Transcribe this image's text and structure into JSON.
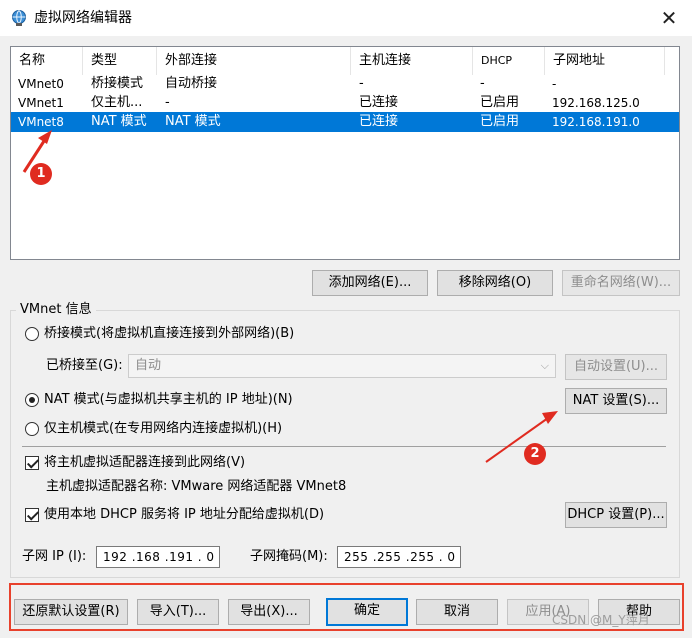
{
  "window": {
    "title": "虚拟网络编辑器",
    "close_icon": "✕"
  },
  "table": {
    "headers": [
      "名称",
      "类型",
      "外部连接",
      "主机连接",
      "DHCP",
      "子网地址"
    ],
    "rows": [
      {
        "name": "VMnet0",
        "type": "桥接模式",
        "external": "自动桥接",
        "host": "-",
        "dhcp": "-",
        "subnet": "-"
      },
      {
        "name": "VMnet1",
        "type": "仅主机...",
        "external": "-",
        "host": "已连接",
        "dhcp": "已启用",
        "subnet": "192.168.125.0"
      },
      {
        "name": "VMnet8",
        "type": "NAT 模式",
        "external": "NAT 模式",
        "host": "已连接",
        "dhcp": "已启用",
        "subnet": "192.168.191.0"
      }
    ],
    "selected_index": 2
  },
  "list_buttons": {
    "add": "添加网络(E)...",
    "remove": "移除网络(O)",
    "rename": "重命名网络(W)..."
  },
  "vmnet_info": {
    "title": "VMnet 信息",
    "bridge_mode": "桥接模式(将虚拟机直接连接到外部网络)(B)",
    "bridged_to_label": "已桥接至(G):",
    "bridged_to_value": "自动",
    "auto_settings": "自动设置(U)...",
    "nat_mode": "NAT 模式(与虚拟机共享主机的 IP 地址)(N)",
    "nat_settings": "NAT 设置(S)...",
    "host_only": "仅主机模式(在专用网络内连接虚拟机)(H)",
    "connect_adapter": "将主机虚拟适配器连接到此网络(V)",
    "adapter_name": "主机虚拟适配器名称: VMware 网络适配器 VMnet8",
    "use_dhcp": "使用本地 DHCP 服务将 IP 地址分配给虚拟机(D)",
    "dhcp_settings": "DHCP 设置(P)...",
    "subnet_ip_label": "子网 IP (I):",
    "subnet_ip": "192 .168 .191 . 0",
    "subnet_mask_label": "子网掩码(M):",
    "subnet_mask": "255 .255 .255 . 0",
    "selected_mode": "nat",
    "connect_adapter_checked": true,
    "use_dhcp_checked": true
  },
  "footer": {
    "restore": "还原默认设置(R)",
    "import": "导入(T)...",
    "export": "导出(X)...",
    "ok": "确定",
    "cancel": "取消",
    "apply": "应用(A)",
    "help": "帮助"
  },
  "annotations": {
    "badge1": "1",
    "badge2": "2"
  },
  "watermark": "CSDN @M_Y萍月",
  "colors": {
    "selection": "#0078d7",
    "annotation_red": "#e02b20",
    "accent_blue": "#0078d7"
  }
}
